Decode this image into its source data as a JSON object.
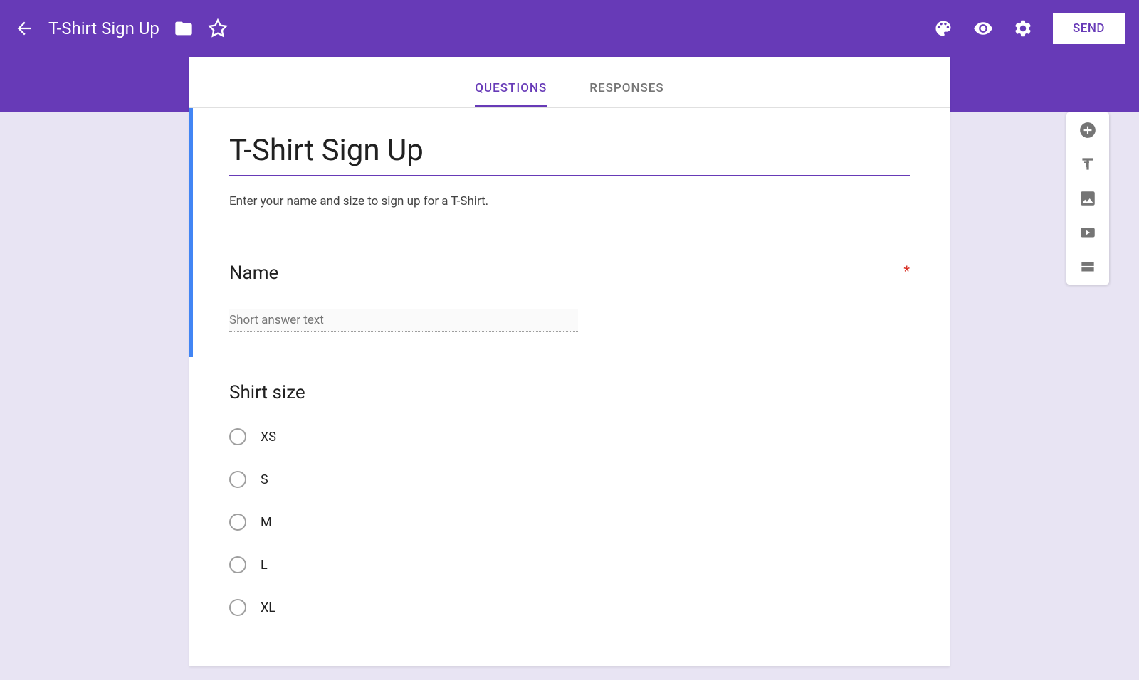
{
  "header": {
    "title": "T-Shirt Sign Up",
    "send_button": "SEND"
  },
  "tabs": {
    "questions": "QUESTIONS",
    "responses": "RESPONSES"
  },
  "form": {
    "title": "T-Shirt Sign Up",
    "description": "Enter your name and size to sign up for a T-Shirt."
  },
  "questions": [
    {
      "title": "Name",
      "required": true,
      "placeholder": "Short answer text"
    },
    {
      "title": "Shirt size",
      "options": [
        "XS",
        "S",
        "M",
        "L",
        "XL"
      ]
    }
  ]
}
